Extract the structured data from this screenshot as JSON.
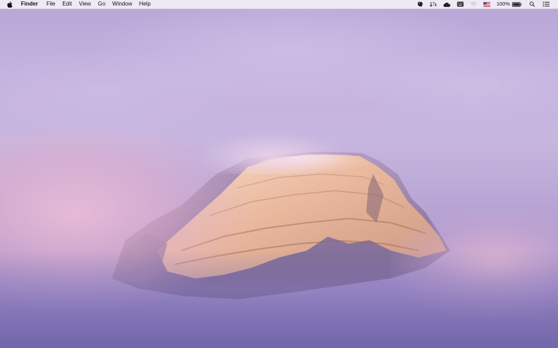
{
  "menubar": {
    "apple_icon": "apple-logo-icon",
    "app_name": "Finder",
    "items": [
      "File",
      "Edit",
      "View",
      "Go",
      "Window",
      "Help"
    ],
    "status": {
      "icons": [
        "evernote-icon",
        "network-activity-icon",
        "cloud-icon",
        "keyboard-icon",
        "wifi-icon",
        "us-flag-input-icon",
        "battery-icon",
        "spotlight-search-icon",
        "notification-center-icon"
      ],
      "battery_percent": "100%"
    }
  },
  "wallpaper": {
    "subject": "snow-covered mountain peak in pink clouds",
    "colors": {
      "sky": "#c4b2df",
      "cloud_pink": "#eebfd7",
      "rock_lit": "#f0c7a8",
      "rock_shadow": "#6d5c86",
      "fog": "#8676b3"
    }
  }
}
